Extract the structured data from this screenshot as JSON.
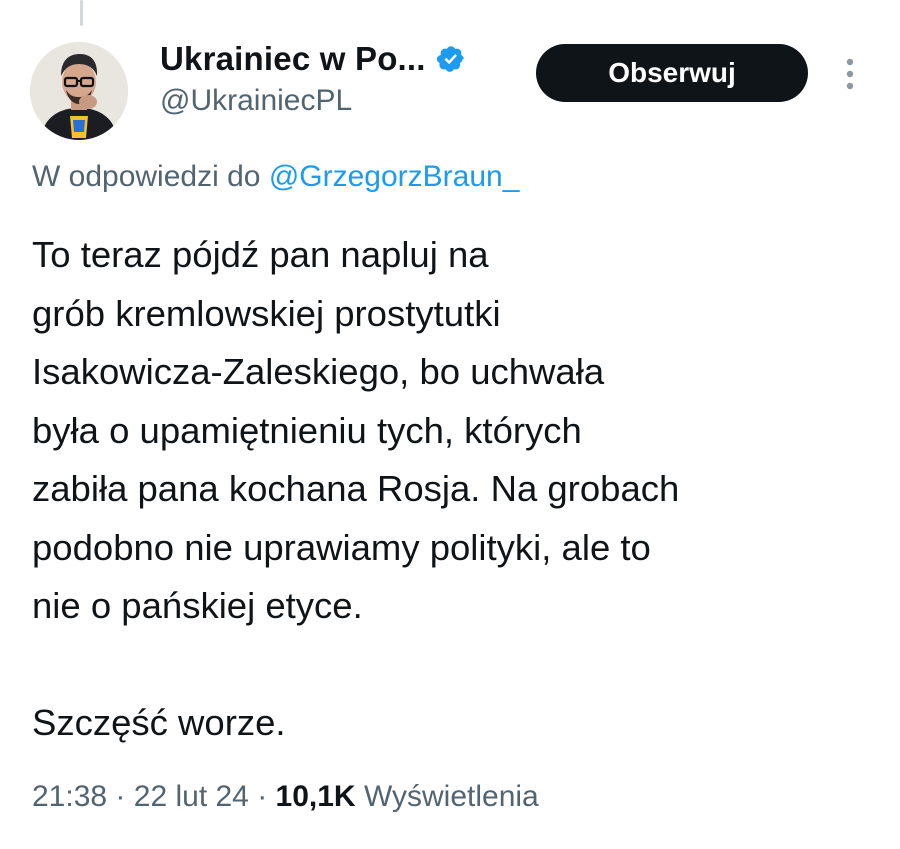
{
  "author": {
    "display_name": "Ukrainiec w Po...",
    "handle": "@UkrainiecPL",
    "verified": true,
    "verified_color": "#1d9bf0"
  },
  "follow_button": {
    "label": "Obserwuj"
  },
  "more_menu": {
    "icon": "more-vertical-icon"
  },
  "reply_context": {
    "prefix": "W odpowiedzi do",
    "mention": "@GrzegorzBraun_"
  },
  "tweet": {
    "lines": [
      "To teraz pójdź pan napluj na",
      "grób kremlowskiej prostytutki",
      "Isakowicza-Zaleskiego, bo uchwała",
      "była o upamiętnieniu tych, których",
      "zabiła pana kochana Rosja. Na grobach",
      "podobno nie uprawiamy polityki, ale to",
      "nie o pańskiej etyce.",
      "",
      "Szczęść worze."
    ]
  },
  "meta": {
    "time": "21:38",
    "separator": "·",
    "date": "22 lut 24",
    "views_count": "10,1K",
    "views_label": "Wyświetlenia"
  },
  "colors": {
    "text_primary": "#0f1419",
    "text_secondary": "#536471",
    "link": "#1d9bf0",
    "button_bg": "#0f1419"
  }
}
